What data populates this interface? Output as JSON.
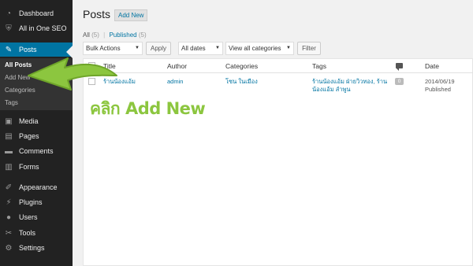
{
  "sidebar": {
    "items": [
      {
        "label": "Dashboard",
        "icon": "dashboard-icon",
        "glyph": "◔"
      },
      {
        "label": "All in One SEO",
        "icon": "shield-icon",
        "glyph": "⛨"
      },
      {
        "label": "Posts",
        "icon": "pin-icon",
        "glyph": "✎",
        "active": true
      },
      {
        "label": "Media",
        "icon": "media-icon",
        "glyph": "▣"
      },
      {
        "label": "Pages",
        "icon": "pages-icon",
        "glyph": "▤"
      },
      {
        "label": "Comments",
        "icon": "comment-icon",
        "glyph": "▬"
      },
      {
        "label": "Forms",
        "icon": "forms-icon",
        "glyph": "▥"
      },
      {
        "label": "Appearance",
        "icon": "brush-icon",
        "glyph": "✐"
      },
      {
        "label": "Plugins",
        "icon": "plug-icon",
        "glyph": "⚡"
      },
      {
        "label": "Users",
        "icon": "users-icon",
        "glyph": "●"
      },
      {
        "label": "Tools",
        "icon": "wrench-icon",
        "glyph": "✂"
      },
      {
        "label": "Settings",
        "icon": "settings-icon",
        "glyph": "⚙"
      }
    ],
    "submenu": [
      "All Posts",
      "Add New",
      "Categories",
      "Tags"
    ]
  },
  "header": {
    "title": "Posts",
    "add_new_label": "Add New"
  },
  "filters": {
    "all_label": "All",
    "all_count": "(5)",
    "separator": "|",
    "published_label": "Published",
    "published_count": "(5)"
  },
  "toolbar": {
    "bulk_actions": "Bulk Actions",
    "apply": "Apply",
    "all_dates": "All dates",
    "all_categories": "View all categories",
    "filter": "Filter"
  },
  "table": {
    "columns": {
      "title": "Title",
      "author": "Author",
      "categories": "Categories",
      "tags": "Tags",
      "date": "Date"
    },
    "rows": [
      {
        "title": "ร้านน้องแอ้ม",
        "author": "admin",
        "categories": "โซน ในเมือง",
        "tags_line1": "ร้านน้องแอ้ม ฝ่ายวิวทอง, ร้าน",
        "tags_line2": "น้องแอ้ม ลำพูน",
        "comments": "0",
        "date": "2014/06/19",
        "status": "Published"
      }
    ]
  },
  "annotation": {
    "text": "คลิก Add New",
    "color": "#8cc63f"
  },
  "colors": {
    "sidebar_bg": "#222222",
    "active_bg": "#0074a2",
    "link": "#0074a2"
  }
}
